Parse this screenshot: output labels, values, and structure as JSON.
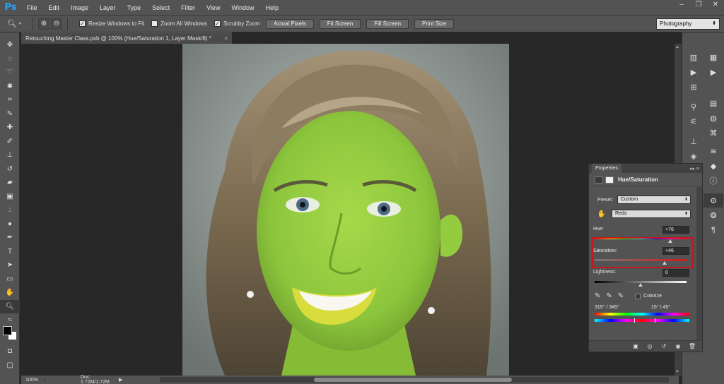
{
  "app": {
    "logo": "Ps"
  },
  "menu": [
    "File",
    "Edit",
    "Image",
    "Layer",
    "Type",
    "Select",
    "Filter",
    "View",
    "Window",
    "Help"
  ],
  "window_controls": {
    "minimize": "–",
    "restore": "❐",
    "close": "✕"
  },
  "options": {
    "resize_windows_label": "Resize Windows to Fit",
    "resize_windows_checked": true,
    "zoom_all_label": "Zoom All Windows",
    "zoom_all_checked": false,
    "scrubby_label": "Scrubby Zoom",
    "scrubby_checked": true,
    "actual_pixels": "Actual Pixels",
    "fit_screen": "Fit Screen",
    "fill_screen": "Fill Screen",
    "print_size": "Print Size",
    "workspace": "Photography"
  },
  "document": {
    "tab_title": "Retouching Master Class.psb @ 100% (Hue/Saturation 1, Layer Mask/8) *",
    "close": "×"
  },
  "status": {
    "zoom": "100%",
    "doc": "Doc: 1.72M/1.72M"
  },
  "properties": {
    "tab": "Properties",
    "title": "Hue/Saturation",
    "preset_label": "Preset:",
    "preset_value": "Custom",
    "channel_value": "Reds",
    "hue_label": "Hue:",
    "hue_value": "+76",
    "saturation_label": "Saturation:",
    "saturation_value": "+46",
    "lightness_label": "Lightness:",
    "lightness_value": "0",
    "colorize_label": "Colorize",
    "range_left": "315° /  345°",
    "range_right": "15° \\ 45°"
  },
  "colors": {
    "accent": "#2fa3f2",
    "highlight_box": "#c8141c",
    "panel": "#535353"
  }
}
